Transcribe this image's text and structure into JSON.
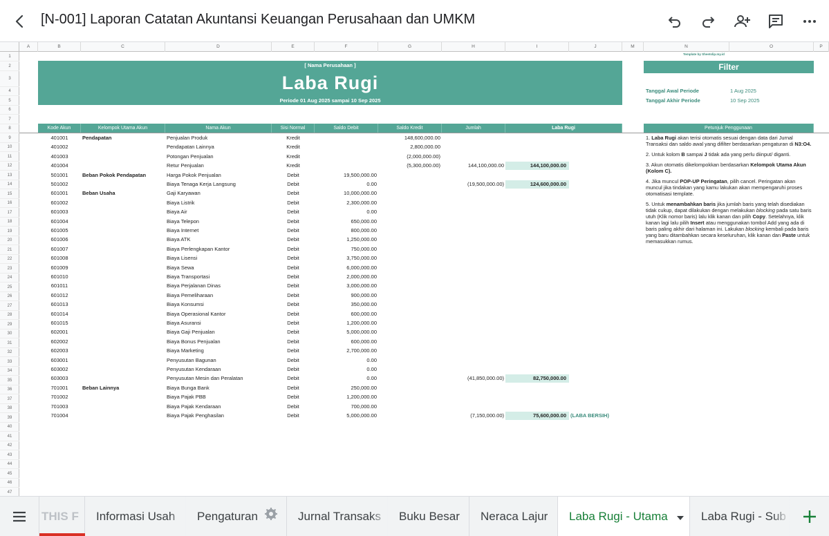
{
  "header": {
    "title": "[N-001] Laporan Catatan Akuntansi Keuangan Perusahaan dan UMKM",
    "icons": [
      "back-arrow-icon",
      "undo-icon",
      "redo-icon",
      "add-person-icon",
      "comment-icon",
      "more-icon"
    ]
  },
  "columns": [
    "A",
    "B",
    "C",
    "D",
    "E",
    "F",
    "G",
    "H",
    "I",
    "J",
    "M",
    "N",
    "O",
    "P"
  ],
  "row_numbers": [
    "1",
    "2",
    "3",
    "4",
    "5",
    "6",
    "7",
    "8",
    "9",
    "10",
    "11",
    "12",
    "13",
    "14",
    "15",
    "16",
    "17",
    "18",
    "19",
    "20",
    "21",
    "22",
    "23",
    "24",
    "25",
    "26",
    "27",
    "28",
    "29",
    "30",
    "31",
    "32",
    "33",
    "34",
    "35",
    "36",
    "37",
    "38",
    "39",
    "40",
    "41",
    "42",
    "43",
    "44",
    "45",
    "46",
    "47"
  ],
  "banner": {
    "company": "[ Nama Perusahaan ]",
    "title": "Laba Rugi",
    "period": "Periode 01 Aug 2025 sampai 10 Sep 2025"
  },
  "template_credit": "Template by Sheetslip.my.id",
  "filter": {
    "title": "Filter",
    "start_label": "Tanggal Awal Periode",
    "start_value": "1 Aug 2025",
    "end_label": "Tanggal Akhir Periode",
    "end_value": "10 Sep 2025",
    "guide_header": "Petunjuk Penggunaan"
  },
  "table_headers": [
    "Kode Akun",
    "Kelompok Utama Akun",
    "Nama Akun",
    "Sisi Normal",
    "Saldo Debit",
    "Saldo Kredit",
    "Jumlah",
    "Laba Rugi"
  ],
  "rows": [
    {
      "kode": "401001",
      "kelompok": "Pendapatan",
      "nama": "Penjualan Produk",
      "sisi": "Kredit",
      "debit": "",
      "kredit": "148,600,000.00",
      "jumlah": "",
      "laba": ""
    },
    {
      "kode": "401002",
      "kelompok": "",
      "nama": "Pendapatan Lainnya",
      "sisi": "Kredit",
      "debit": "",
      "kredit": "2,800,000.00",
      "jumlah": "",
      "laba": ""
    },
    {
      "kode": "401003",
      "kelompok": "",
      "nama": "Potongan Penjualan",
      "sisi": "Kredit",
      "debit": "",
      "kredit": "(2,000,000.00)",
      "jumlah": "",
      "laba": ""
    },
    {
      "kode": "401004",
      "kelompok": "",
      "nama": "Retur Penjualan",
      "sisi": "Kredit",
      "debit": "",
      "kredit": "(5,300,000.00)",
      "jumlah": "144,100,000.00",
      "laba": "144,100,000.00"
    },
    {
      "kode": "501001",
      "kelompok": "Beban Pokok Pendapatan",
      "nama": "Harga Pokok Penjualan",
      "sisi": "Debit",
      "debit": "19,500,000.00",
      "kredit": "",
      "jumlah": "",
      "laba": ""
    },
    {
      "kode": "501002",
      "kelompok": "",
      "nama": "Biaya Tenaga Kerja Langsung",
      "sisi": "Debit",
      "debit": "0.00",
      "kredit": "",
      "jumlah": "(19,500,000.00)",
      "laba": "124,600,000.00"
    },
    {
      "kode": "601001",
      "kelompok": "Beban Usaha",
      "nama": "Gaji Karyawan",
      "sisi": "Debit",
      "debit": "10,000,000.00",
      "kredit": "",
      "jumlah": "",
      "laba": ""
    },
    {
      "kode": "601002",
      "kelompok": "",
      "nama": "Biaya Listrik",
      "sisi": "Debit",
      "debit": "2,300,000.00",
      "kredit": "",
      "jumlah": "",
      "laba": ""
    },
    {
      "kode": "601003",
      "kelompok": "",
      "nama": "Biaya Air",
      "sisi": "Debit",
      "debit": "0.00",
      "kredit": "",
      "jumlah": "",
      "laba": ""
    },
    {
      "kode": "601004",
      "kelompok": "",
      "nama": "Biaya Telepon",
      "sisi": "Debit",
      "debit": "650,000.00",
      "kredit": "",
      "jumlah": "",
      "laba": ""
    },
    {
      "kode": "601005",
      "kelompok": "",
      "nama": "Biaya Internet",
      "sisi": "Debit",
      "debit": "800,000.00",
      "kredit": "",
      "jumlah": "",
      "laba": ""
    },
    {
      "kode": "601006",
      "kelompok": "",
      "nama": "Biaya ATK",
      "sisi": "Debit",
      "debit": "1,250,000.00",
      "kredit": "",
      "jumlah": "",
      "laba": ""
    },
    {
      "kode": "601007",
      "kelompok": "",
      "nama": "Biaya Perlengkapan Kantor",
      "sisi": "Debit",
      "debit": "750,000.00",
      "kredit": "",
      "jumlah": "",
      "laba": ""
    },
    {
      "kode": "601008",
      "kelompok": "",
      "nama": "Biaya Lisensi",
      "sisi": "Debit",
      "debit": "3,750,000.00",
      "kredit": "",
      "jumlah": "",
      "laba": ""
    },
    {
      "kode": "601009",
      "kelompok": "",
      "nama": "Biaya Sewa",
      "sisi": "Debit",
      "debit": "6,000,000.00",
      "kredit": "",
      "jumlah": "",
      "laba": ""
    },
    {
      "kode": "601010",
      "kelompok": "",
      "nama": "Biaya Transportasi",
      "sisi": "Debit",
      "debit": "2,000,000.00",
      "kredit": "",
      "jumlah": "",
      "laba": ""
    },
    {
      "kode": "601011",
      "kelompok": "",
      "nama": "Biaya Perjalanan Dinas",
      "sisi": "Debit",
      "debit": "3,000,000.00",
      "kredit": "",
      "jumlah": "",
      "laba": ""
    },
    {
      "kode": "601012",
      "kelompok": "",
      "nama": "Biaya Pemeliharaan",
      "sisi": "Debit",
      "debit": "900,000.00",
      "kredit": "",
      "jumlah": "",
      "laba": ""
    },
    {
      "kode": "601013",
      "kelompok": "",
      "nama": "Biaya Konsumsi",
      "sisi": "Debit",
      "debit": "350,000.00",
      "kredit": "",
      "jumlah": "",
      "laba": ""
    },
    {
      "kode": "601014",
      "kelompok": "",
      "nama": "Biaya Operasional Kantor",
      "sisi": "Debit",
      "debit": "600,000.00",
      "kredit": "",
      "jumlah": "",
      "laba": ""
    },
    {
      "kode": "601015",
      "kelompok": "",
      "nama": "Biaya Asuransi",
      "sisi": "Debit",
      "debit": "1,200,000.00",
      "kredit": "",
      "jumlah": "",
      "laba": ""
    },
    {
      "kode": "602001",
      "kelompok": "",
      "nama": "Biaya Gaji Penjualan",
      "sisi": "Debit",
      "debit": "5,000,000.00",
      "kredit": "",
      "jumlah": "",
      "laba": ""
    },
    {
      "kode": "602002",
      "kelompok": "",
      "nama": "Biaya Bonus Penjualan",
      "sisi": "Debit",
      "debit": "600,000.00",
      "kredit": "",
      "jumlah": "",
      "laba": ""
    },
    {
      "kode": "602003",
      "kelompok": "",
      "nama": "Biaya Marketing",
      "sisi": "Debit",
      "debit": "2,700,000.00",
      "kredit": "",
      "jumlah": "",
      "laba": ""
    },
    {
      "kode": "603001",
      "kelompok": "",
      "nama": "Penyusutan Bagunan",
      "sisi": "Debit",
      "debit": "0.00",
      "kredit": "",
      "jumlah": "",
      "laba": ""
    },
    {
      "kode": "603002",
      "kelompok": "",
      "nama": "Penyusutan Kendaraan",
      "sisi": "Debit",
      "debit": "0.00",
      "kredit": "",
      "jumlah": "",
      "laba": ""
    },
    {
      "kode": "603003",
      "kelompok": "",
      "nama": "Penyusutan Mesin dan Peralatan",
      "sisi": "Debit",
      "debit": "0.00",
      "kredit": "",
      "jumlah": "(41,850,000.00)",
      "laba": "82,750,000.00"
    },
    {
      "kode": "701001",
      "kelompok": "Beban Lainnya",
      "nama": "Biaya Bunga Bank",
      "sisi": "Debit",
      "debit": "250,000.00",
      "kredit": "",
      "jumlah": "",
      "laba": ""
    },
    {
      "kode": "701002",
      "kelompok": "",
      "nama": "Biaya Pajak PBB",
      "sisi": "Debit",
      "debit": "1,200,000.00",
      "kredit": "",
      "jumlah": "",
      "laba": ""
    },
    {
      "kode": "701003",
      "kelompok": "",
      "nama": "Biaya Pajak Kendaraan",
      "sisi": "Debit",
      "debit": "700,000.00",
      "kredit": "",
      "jumlah": "",
      "laba": ""
    },
    {
      "kode": "701004",
      "kelompok": "",
      "nama": "Biaya Pajak Penghasilan",
      "sisi": "Debit",
      "debit": "5,000,000.00",
      "kredit": "",
      "jumlah": "(7,150,000.00)",
      "laba": "75,600,000.00"
    }
  ],
  "net_label": "(LABA BERSIH)",
  "notes_html": [
    "1. <b>Laba Rugi</b> akan terisi otomatis sesuai dengan data dari Jurnal Transaksi dan saldo awal yang difilter berdasarkan pengaturan di <b>N3:O4.</b>",
    "2. Untuk kolom <b>B</b> sampai <b>J</b> tidak ada yang perlu diinput/ diganti.",
    "3. Akun otomatis dikelompokkan berdasarkan <b>Kelompok Utama Akun (Kolom C).</b>",
    "4. Jika muncul <b>POP-UP Peringatan</b>, pilih cancel. Peringatan akan muncul jika tindakan yang kamu lakukan akan mempengaruhi proses otomatisasi template.",
    "5. Untuk <b>menambahkan baris</b> jika jumlah baris yang telah disediakan tidak cukup, dapat dilakukan dengan melakukan <i>blocking</i> pada satu baris utuh (Klik nomor baris) lalu klik kanan dan pilih <b>Copy</b>. Setelahnya, klik kanan lagi lalu pilih <b>Insert</b> atau menggunakan tombol Add yang ada di baris paling akhir dari halaman ini. Lakukan <i>blocking</i> kembali pada baris yang baru ditambahkan secara keseluruhan, klik kanan dan <b>Paste</b> untuk memasukkan rumus."
  ],
  "tabs": [
    {
      "label": "THIS F",
      "active": false
    },
    {
      "label": "Informasi Usah",
      "active": false
    },
    {
      "label": "Pengaturan",
      "active": false
    },
    {
      "label": "Jurnal Transaks",
      "active": false
    },
    {
      "label": "Buku Besar",
      "active": false
    },
    {
      "label": "Neraca Lajur",
      "active": false
    },
    {
      "label": "Laba Rugi - Utama",
      "active": true
    },
    {
      "label": "Laba Rugi - Sub",
      "active": false
    }
  ],
  "colors": {
    "accent": "#54a696",
    "highlight": "#d4ede7",
    "sheet_tab_active": "#188038",
    "red_marker": "#d93025"
  }
}
